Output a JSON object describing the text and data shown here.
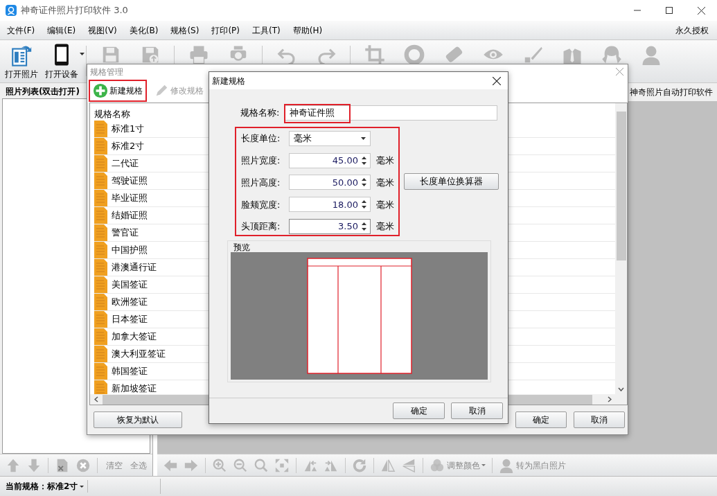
{
  "window": {
    "title": "神奇证件照片打印软件 3.0"
  },
  "menu": [
    "文件(F)",
    "编辑(E)",
    "视图(V)",
    "美化(B)",
    "规格(S)",
    "打印(P)",
    "工具(T)",
    "帮助(H)"
  ],
  "license": "永久授权",
  "toolbar": [
    {
      "kind": "open-photo",
      "label": "打开照片",
      "disabled": false
    },
    {
      "kind": "device",
      "label": "打开设备",
      "disabled": false
    },
    {
      "kind": "separator"
    },
    {
      "kind": "save",
      "disabled": true
    },
    {
      "kind": "save-as",
      "disabled": true
    },
    {
      "kind": "separator"
    },
    {
      "kind": "print",
      "disabled": true
    },
    {
      "kind": "print-preview",
      "disabled": true
    },
    {
      "kind": "separator"
    },
    {
      "kind": "undo",
      "disabled": true
    },
    {
      "kind": "redo",
      "disabled": true
    },
    {
      "kind": "separator"
    },
    {
      "kind": "crop",
      "disabled": true
    },
    {
      "kind": "ring",
      "disabled": true
    },
    {
      "kind": "eraser",
      "disabled": true
    },
    {
      "kind": "eye",
      "disabled": true
    },
    {
      "kind": "brush",
      "disabled": true
    },
    {
      "kind": "suit",
      "disabled": true
    },
    {
      "kind": "hair",
      "disabled": true
    },
    {
      "kind": "person",
      "disabled": true
    }
  ],
  "photo_list": {
    "title": "照片列表(双击打开)",
    "tools": [
      {
        "kind": "up",
        "disabled": true
      },
      {
        "kind": "down",
        "disabled": true
      },
      {
        "kind": "separator"
      },
      {
        "kind": "file-delete",
        "disabled": true
      },
      {
        "kind": "close-circle",
        "disabled": true
      },
      {
        "kind": "separator"
      },
      {
        "kind": "text",
        "label": "清空",
        "disabled": true
      },
      {
        "kind": "text",
        "label": "全选",
        "disabled": true
      }
    ]
  },
  "right_panel": {
    "tab": "神奇照片自动打印软件",
    "tools": [
      {
        "kind": "left",
        "disabled": true
      },
      {
        "kind": "right",
        "disabled": true
      },
      {
        "kind": "separator"
      },
      {
        "kind": "zoom-in",
        "disabled": true
      },
      {
        "kind": "zoom-out",
        "disabled": true
      },
      {
        "kind": "zoom",
        "disabled": true
      },
      {
        "kind": "fit",
        "disabled": true
      },
      {
        "kind": "separator"
      },
      {
        "kind": "mirror-left",
        "disabled": true
      },
      {
        "kind": "mirror-right",
        "disabled": true
      },
      {
        "kind": "separator"
      },
      {
        "kind": "rotate",
        "disabled": true
      },
      {
        "kind": "separator"
      },
      {
        "kind": "flip-h",
        "disabled": true
      },
      {
        "kind": "flip-v",
        "disabled": true
      },
      {
        "kind": "separator"
      },
      {
        "kind": "color",
        "label": "调整颜色",
        "disabled": true
      },
      {
        "kind": "separator"
      },
      {
        "kind": "bw",
        "label": "转为黑白照片",
        "disabled": true
      }
    ]
  },
  "status_bar": {
    "current_spec": "当前规格：标准2寸"
  },
  "spec_manager": {
    "title": "规格管理",
    "tools": [
      {
        "kind": "add",
        "label": "新建规格",
        "disabled": false,
        "highlighted": true
      },
      {
        "kind": "edit",
        "label": "修改规格",
        "disabled": true,
        "highlighted": false
      }
    ],
    "column": "规格名称",
    "items": [
      "标准1寸",
      "标准2寸",
      "二代证",
      "驾驶证照",
      "毕业证照",
      "结婚证照",
      "警官证",
      "中国护照",
      "港澳通行证",
      "美国签证",
      "欧洲签证",
      "日本签证",
      "加拿大签证",
      "澳大利亚签证",
      "韩国签证",
      "新加坡签证"
    ],
    "buttons": [
      "恢复为默认",
      "确定",
      "取消"
    ]
  },
  "new_spec": {
    "title": "新建规格",
    "name_label": "规格名称:",
    "name_value": "神奇证件照",
    "name_highlighted": true,
    "unit_label": "长度单位:",
    "unit_value": "毫米",
    "group_highlighted": true,
    "fields": [
      {
        "label": "照片宽度:",
        "value": "45.00",
        "unit": "毫米"
      },
      {
        "label": "照片高度:",
        "value": "50.00",
        "unit": "毫米"
      },
      {
        "label": "脸颊宽度:",
        "value": "18.00",
        "unit": "毫米"
      },
      {
        "label": "头顶距离:",
        "value": "3.50",
        "unit": "毫米"
      }
    ],
    "converter": "长度单位换算器",
    "preview": "预览",
    "buttons": [
      "确定",
      "取消"
    ]
  }
}
